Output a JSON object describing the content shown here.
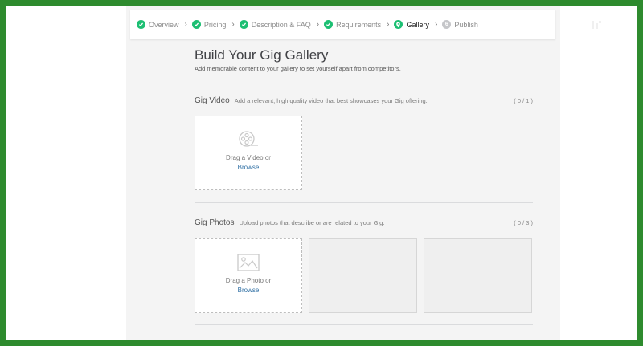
{
  "progress": {
    "steps": [
      {
        "label": "Overview",
        "status": "done"
      },
      {
        "label": "Pricing",
        "status": "done"
      },
      {
        "label": "Description & FAQ",
        "status": "done"
      },
      {
        "label": "Requirements",
        "status": "done"
      },
      {
        "label": "Gallery",
        "status": "current"
      },
      {
        "label": "Publish",
        "status": "pending",
        "number": "6"
      }
    ],
    "separator": "›"
  },
  "page": {
    "title": "Build Your Gig Gallery",
    "subtitle": "Add memorable content to your gallery to set yourself apart from competitors."
  },
  "video_section": {
    "title": "Gig Video",
    "description": "Add a relevant, high quality video that best showcases your Gig offering.",
    "counter": "( 0 / 1 )",
    "drop_text": "Drag a Video or",
    "browse": "Browse",
    "icon": "film-reel-icon"
  },
  "photo_section": {
    "title": "Gig Photos",
    "description": "Upload photos that describe or are related to your Gig.",
    "counter": "( 0 / 3 )",
    "drop_text": "Drag a Photo or",
    "browse": "Browse",
    "icon": "image-icon"
  },
  "colors": {
    "frame": "#2e8b2e",
    "accent_green": "#1dbf73",
    "link": "#2d6ea3"
  }
}
